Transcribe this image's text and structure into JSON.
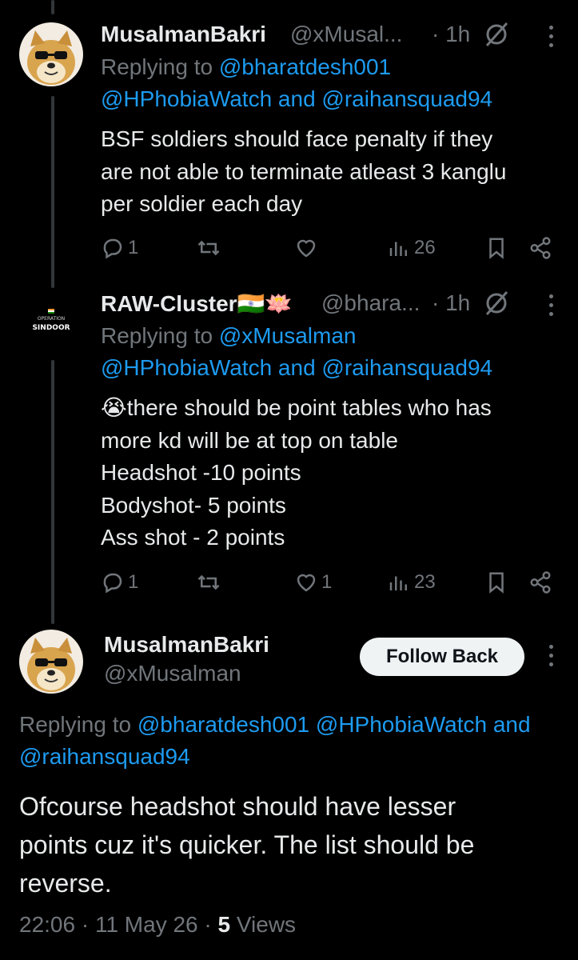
{
  "tweet1": {
    "display_name": "MusalmanBakri",
    "handle": "@xMusal...",
    "time": "· 1h",
    "replying_prefix": "Replying to ",
    "replying_line1_handle": "@bharatdesh001",
    "replying_line2": "@HPhobiaWatch and @raihansquad94",
    "text_lines": [
      "BSF soldiers should face penalty if they",
      "are not able to terminate atleast 3 kanglu",
      "per soldier each day"
    ],
    "replies": "1",
    "retweets": "",
    "likes": "",
    "views": "26"
  },
  "tweet2": {
    "display_name": "RAW-Cluster🇮🇳🪷",
    "handle": "@bhara...",
    "time": "· 1h",
    "avatar_text_top": "OPERATION",
    "avatar_text_bottom": "SINDOOR",
    "replying_prefix": "Replying to ",
    "replying_line1_handle": "@xMusalman",
    "replying_line2": "@HPhobiaWatch and @raihansquad94",
    "text_lines": [
      "😭there should be point tables who has",
      "more kd will be at top on table",
      "Headshot -10 points",
      "Bodyshot- 5 points",
      "Ass shot -  2 points"
    ],
    "replies": "1",
    "retweets": "",
    "likes": "1",
    "views": "23"
  },
  "main": {
    "display_name": "MusalmanBakri",
    "handle": "@xMusalman",
    "follow_label": "Follow Back",
    "replying_prefix": "Replying to ",
    "replying_line1": "@bharatdesh001 @HPhobiaWatch and",
    "replying_line2": "@raihansquad94",
    "text_lines": [
      "Ofcourse headshot should have lesser",
      "points cuz it's quicker. The list should be",
      "reverse."
    ],
    "timestamp": "22:06 · 11 May 26 · ",
    "views_count": "5",
    "views_label": " Views"
  }
}
